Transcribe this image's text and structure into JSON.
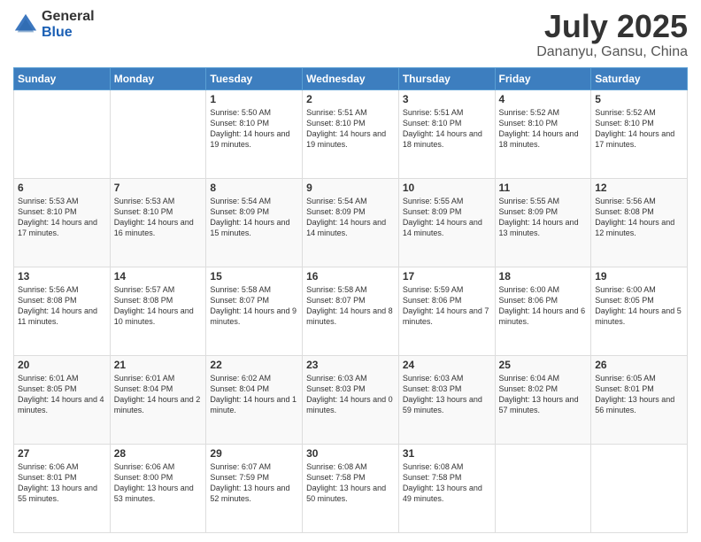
{
  "logo": {
    "general": "General",
    "blue": "Blue"
  },
  "title": "July 2025",
  "subtitle": "Dananyu, Gansu, China",
  "days_header": [
    "Sunday",
    "Monday",
    "Tuesday",
    "Wednesday",
    "Thursday",
    "Friday",
    "Saturday"
  ],
  "weeks": [
    [
      {
        "day": "",
        "info": ""
      },
      {
        "day": "",
        "info": ""
      },
      {
        "day": "1",
        "info": "Sunrise: 5:50 AM\nSunset: 8:10 PM\nDaylight: 14 hours and 19 minutes."
      },
      {
        "day": "2",
        "info": "Sunrise: 5:51 AM\nSunset: 8:10 PM\nDaylight: 14 hours and 19 minutes."
      },
      {
        "day": "3",
        "info": "Sunrise: 5:51 AM\nSunset: 8:10 PM\nDaylight: 14 hours and 18 minutes."
      },
      {
        "day": "4",
        "info": "Sunrise: 5:52 AM\nSunset: 8:10 PM\nDaylight: 14 hours and 18 minutes."
      },
      {
        "day": "5",
        "info": "Sunrise: 5:52 AM\nSunset: 8:10 PM\nDaylight: 14 hours and 17 minutes."
      }
    ],
    [
      {
        "day": "6",
        "info": "Sunrise: 5:53 AM\nSunset: 8:10 PM\nDaylight: 14 hours and 17 minutes."
      },
      {
        "day": "7",
        "info": "Sunrise: 5:53 AM\nSunset: 8:10 PM\nDaylight: 14 hours and 16 minutes."
      },
      {
        "day": "8",
        "info": "Sunrise: 5:54 AM\nSunset: 8:09 PM\nDaylight: 14 hours and 15 minutes."
      },
      {
        "day": "9",
        "info": "Sunrise: 5:54 AM\nSunset: 8:09 PM\nDaylight: 14 hours and 14 minutes."
      },
      {
        "day": "10",
        "info": "Sunrise: 5:55 AM\nSunset: 8:09 PM\nDaylight: 14 hours and 14 minutes."
      },
      {
        "day": "11",
        "info": "Sunrise: 5:55 AM\nSunset: 8:09 PM\nDaylight: 14 hours and 13 minutes."
      },
      {
        "day": "12",
        "info": "Sunrise: 5:56 AM\nSunset: 8:08 PM\nDaylight: 14 hours and 12 minutes."
      }
    ],
    [
      {
        "day": "13",
        "info": "Sunrise: 5:56 AM\nSunset: 8:08 PM\nDaylight: 14 hours and 11 minutes."
      },
      {
        "day": "14",
        "info": "Sunrise: 5:57 AM\nSunset: 8:08 PM\nDaylight: 14 hours and 10 minutes."
      },
      {
        "day": "15",
        "info": "Sunrise: 5:58 AM\nSunset: 8:07 PM\nDaylight: 14 hours and 9 minutes."
      },
      {
        "day": "16",
        "info": "Sunrise: 5:58 AM\nSunset: 8:07 PM\nDaylight: 14 hours and 8 minutes."
      },
      {
        "day": "17",
        "info": "Sunrise: 5:59 AM\nSunset: 8:06 PM\nDaylight: 14 hours and 7 minutes."
      },
      {
        "day": "18",
        "info": "Sunrise: 6:00 AM\nSunset: 8:06 PM\nDaylight: 14 hours and 6 minutes."
      },
      {
        "day": "19",
        "info": "Sunrise: 6:00 AM\nSunset: 8:05 PM\nDaylight: 14 hours and 5 minutes."
      }
    ],
    [
      {
        "day": "20",
        "info": "Sunrise: 6:01 AM\nSunset: 8:05 PM\nDaylight: 14 hours and 4 minutes."
      },
      {
        "day": "21",
        "info": "Sunrise: 6:01 AM\nSunset: 8:04 PM\nDaylight: 14 hours and 2 minutes."
      },
      {
        "day": "22",
        "info": "Sunrise: 6:02 AM\nSunset: 8:04 PM\nDaylight: 14 hours and 1 minute."
      },
      {
        "day": "23",
        "info": "Sunrise: 6:03 AM\nSunset: 8:03 PM\nDaylight: 14 hours and 0 minutes."
      },
      {
        "day": "24",
        "info": "Sunrise: 6:03 AM\nSunset: 8:03 PM\nDaylight: 13 hours and 59 minutes."
      },
      {
        "day": "25",
        "info": "Sunrise: 6:04 AM\nSunset: 8:02 PM\nDaylight: 13 hours and 57 minutes."
      },
      {
        "day": "26",
        "info": "Sunrise: 6:05 AM\nSunset: 8:01 PM\nDaylight: 13 hours and 56 minutes."
      }
    ],
    [
      {
        "day": "27",
        "info": "Sunrise: 6:06 AM\nSunset: 8:01 PM\nDaylight: 13 hours and 55 minutes."
      },
      {
        "day": "28",
        "info": "Sunrise: 6:06 AM\nSunset: 8:00 PM\nDaylight: 13 hours and 53 minutes."
      },
      {
        "day": "29",
        "info": "Sunrise: 6:07 AM\nSunset: 7:59 PM\nDaylight: 13 hours and 52 minutes."
      },
      {
        "day": "30",
        "info": "Sunrise: 6:08 AM\nSunset: 7:58 PM\nDaylight: 13 hours and 50 minutes."
      },
      {
        "day": "31",
        "info": "Sunrise: 6:08 AM\nSunset: 7:58 PM\nDaylight: 13 hours and 49 minutes."
      },
      {
        "day": "",
        "info": ""
      },
      {
        "day": "",
        "info": ""
      }
    ]
  ]
}
